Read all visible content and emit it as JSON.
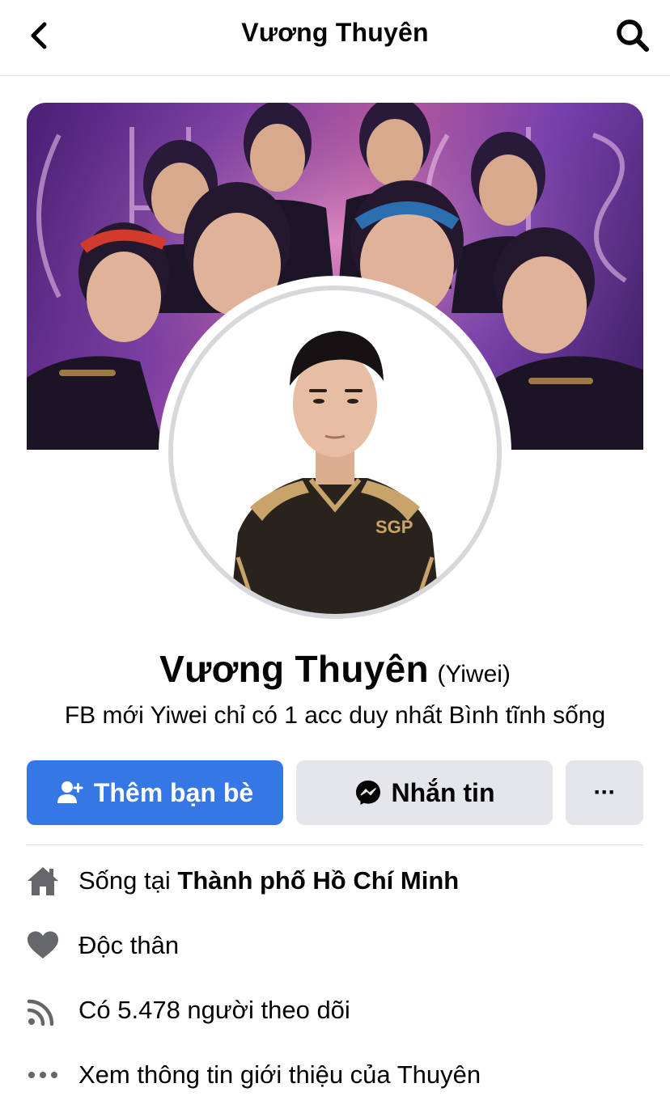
{
  "header": {
    "title": "Vương Thuyên",
    "back_icon": "chevron-left-icon",
    "search_icon": "search-icon"
  },
  "profile": {
    "name": "Vương Thuyên",
    "alternate_name": "(Yiwei)",
    "bio": "FB mới Yiwei chỉ có 1 acc duy nhất Bình tĩnh sống"
  },
  "actions": {
    "add_friend": {
      "label": "Thêm bạn bè",
      "icon": "add-friend-icon"
    },
    "message": {
      "label": "Nhắn tin",
      "icon": "messenger-icon"
    },
    "more": {
      "label": "···",
      "icon": "more-icon"
    }
  },
  "intro": {
    "lives_in_prefix": "Sống tại",
    "lives_in_city": "Thành phố Hồ Chí Minh",
    "relationship": "Độc thân",
    "followers": "Có 5.478 người theo dõi",
    "see_about": "Xem thông tin giới thiệu của Thuyên"
  },
  "colors": {
    "primary_button": "#3578e5",
    "secondary_button": "#e4e6eb",
    "icon_gray": "#65676b",
    "text": "#050505"
  }
}
